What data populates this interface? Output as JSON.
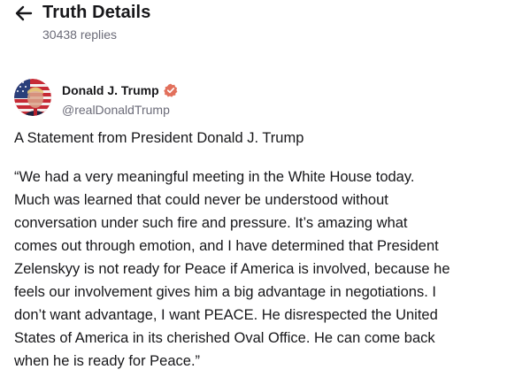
{
  "header": {
    "title": "Truth Details",
    "replies": "30438 replies"
  },
  "post": {
    "author_name": "Donald J. Trump",
    "author_handle": "@realDonaldTrump",
    "heading": "A Statement from President Donald J. Trump",
    "body": "“We had a very meaningful meeting in the White House today.\nMuch was learned that could never be understood without\nconversation under such fire and pressure. It’s amazing what\ncomes out through emotion, and I have determined that President\nZelenskyy is not ready for Peace if America is involved, because he\nfeels our involvement gives him a big advantage in negotiations. I\ndon’t want advantage, I want PEACE. He disrespected the United\nStates of America in its cherished Oval Office. He can come back\nwhen he is ready for Peace.”"
  },
  "icons": {
    "back": "arrow-left-icon",
    "verified": "verified-badge-icon"
  },
  "colors": {
    "text_primary": "#17171a",
    "text_secondary": "#6b6b78",
    "verified_badge": "#e2705c",
    "background": "#ffffff"
  }
}
